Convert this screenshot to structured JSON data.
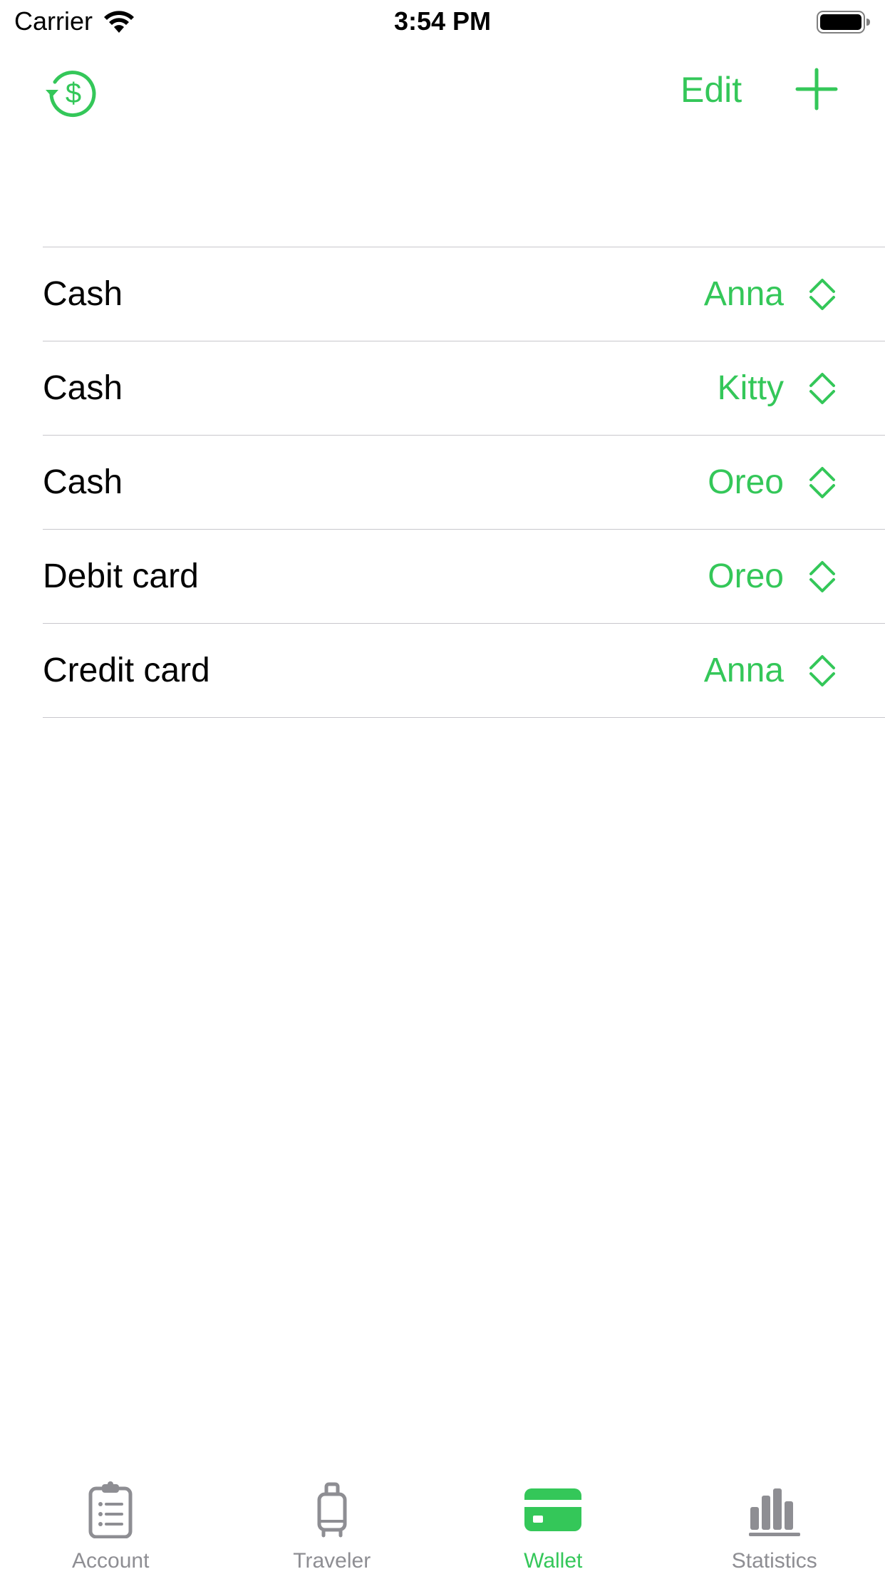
{
  "status_bar": {
    "carrier": "Carrier",
    "time": "3:54 PM"
  },
  "nav": {
    "left_icon": "history-dollar-icon",
    "edit_label": "Edit",
    "right_icon": "plus-icon"
  },
  "wallets": [
    {
      "label": "Cash",
      "owner": "Anna"
    },
    {
      "label": "Cash",
      "owner": "Kitty"
    },
    {
      "label": "Cash",
      "owner": "Oreo"
    },
    {
      "label": "Debit card",
      "owner": "Oreo"
    },
    {
      "label": "Credit card",
      "owner": "Anna"
    }
  ],
  "tabs": [
    {
      "label": "Account",
      "icon": "clipboard-icon",
      "active": false
    },
    {
      "label": "Traveler",
      "icon": "suitcase-icon",
      "active": false
    },
    {
      "label": "Wallet",
      "icon": "credit-card-icon",
      "active": true
    },
    {
      "label": "Statistics",
      "icon": "bar-chart-icon",
      "active": false
    }
  ],
  "colors": {
    "accent": "#34c759",
    "inactive": "#8e8e93",
    "separator": "#c8c7cc"
  }
}
